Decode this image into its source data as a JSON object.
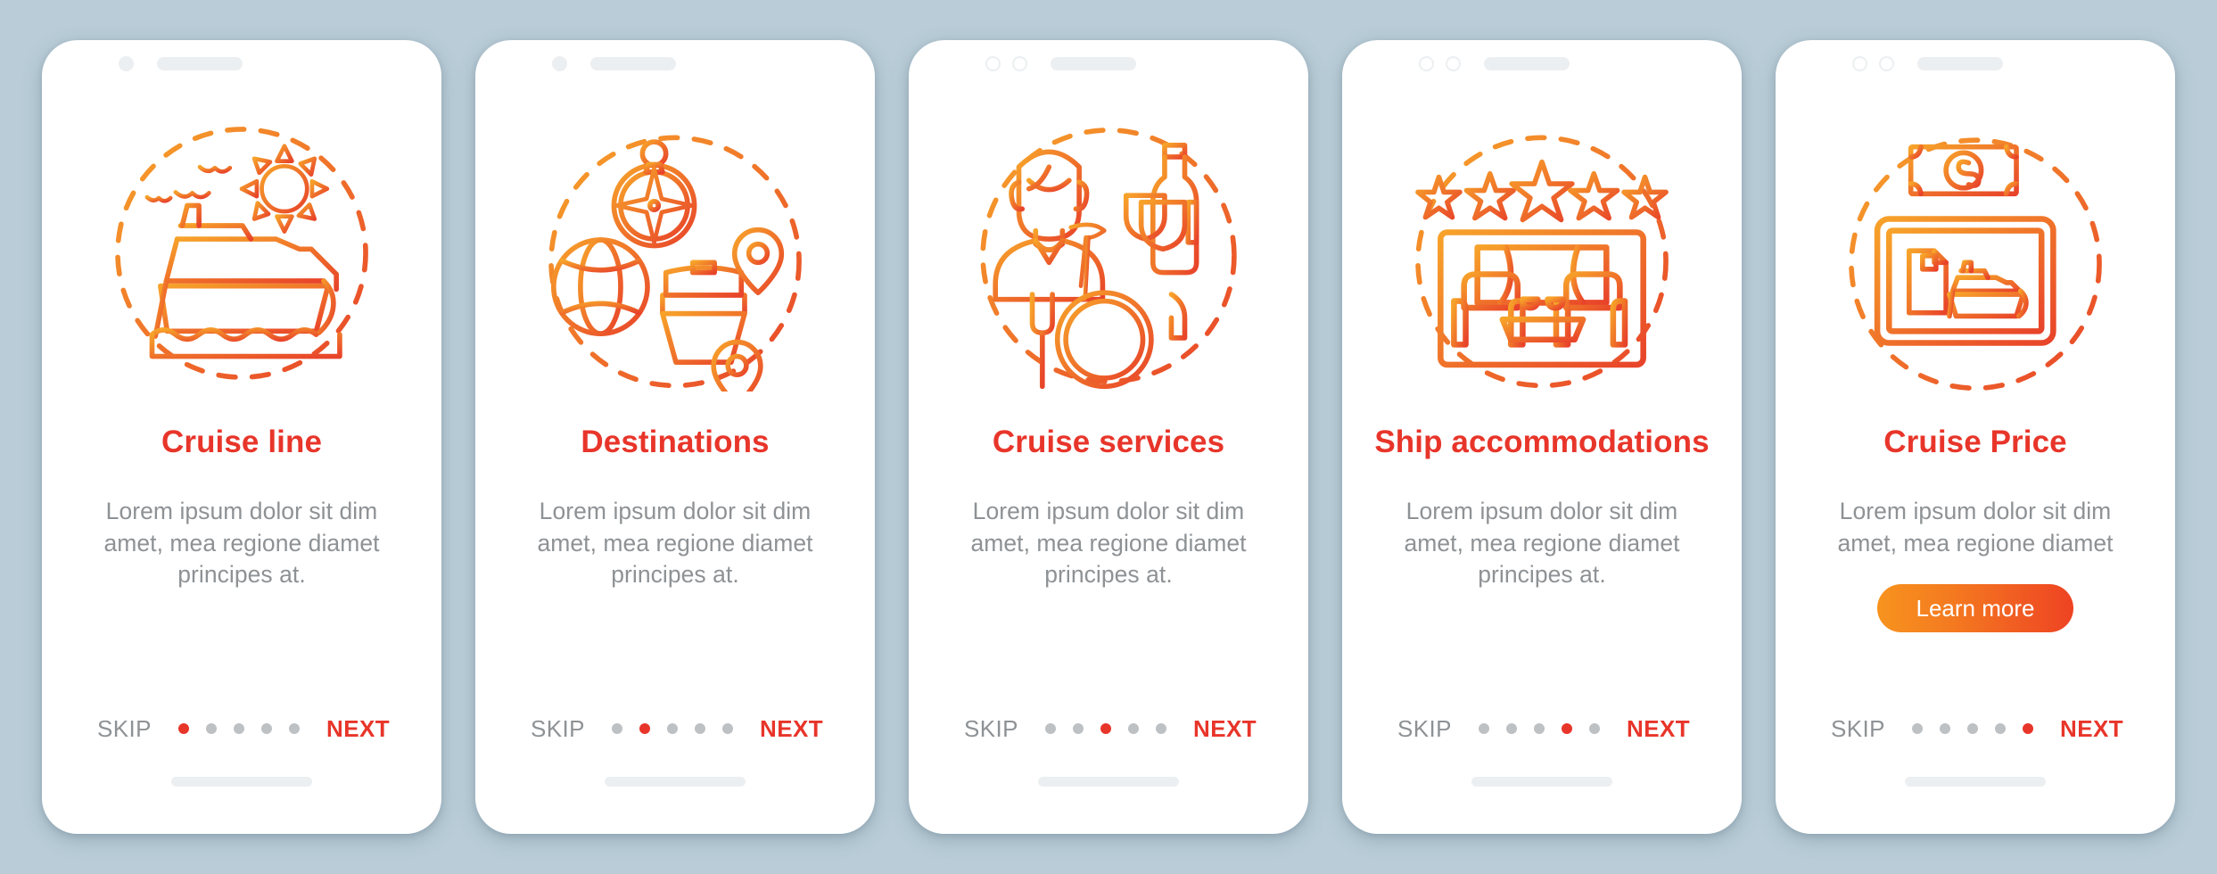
{
  "theme": {
    "background": "#b9ccd7",
    "card_background": "#ffffff",
    "title_color": "#e8352a",
    "body_text_color": "#8e9295",
    "accent_orange": "#f7931e",
    "accent_red": "#ee4323",
    "dot_inactive": "#bdc1c4",
    "dot_active": "#e8352a"
  },
  "common": {
    "skip_label": "SKIP",
    "next_label": "NEXT",
    "description": "Lorem ipsum dolor sit dim amet, mea regione diamet principes at.",
    "description_short": "Lorem ipsum dolor sit dim amet, mea regione diamet",
    "total_steps": 5
  },
  "screens": [
    {
      "id": "cruise-line",
      "title": "Cruise line",
      "description": "Lorem ipsum dolor sit dim amet, mea regione diamet principes at.",
      "skip_label": "SKIP",
      "next_label": "NEXT",
      "active_step": 1,
      "icon_name": "cruise-ship-sun-icon",
      "status_indicators": "one-solid-dot",
      "cta": null
    },
    {
      "id": "destinations",
      "title": "Destinations",
      "description": "Lorem ipsum dolor sit dim amet, mea regione diamet principes at.",
      "skip_label": "SKIP",
      "next_label": "NEXT",
      "active_step": 2,
      "icon_name": "compass-globe-ship-pin-icon",
      "status_indicators": "one-solid-dot",
      "cta": null
    },
    {
      "id": "cruise-services",
      "title": "Cruise services",
      "description": "Lorem ipsum dolor sit dim amet, mea regione diamet principes at.",
      "skip_label": "SKIP",
      "next_label": "NEXT",
      "active_step": 3,
      "icon_name": "waitress-dinner-wine-icon",
      "status_indicators": "two-ring-dots",
      "cta": null
    },
    {
      "id": "ship-accommodations",
      "title": "Ship accommodations",
      "description": "Lorem ipsum dolor sit dim amet, mea regione diamet principes at.",
      "skip_label": "SKIP",
      "next_label": "NEXT",
      "active_step": 4,
      "icon_name": "five-stars-cabin-lounge-icon",
      "status_indicators": "two-ring-dots",
      "cta": null
    },
    {
      "id": "cruise-price",
      "title": "Cruise Price",
      "description": "Lorem ipsum dolor sit dim amet, mea regione diamet",
      "skip_label": "SKIP",
      "next_label": "NEXT",
      "active_step": 5,
      "icon_name": "banknote-monitor-ship-icon",
      "status_indicators": "two-ring-dots",
      "cta": "Learn more"
    }
  ]
}
